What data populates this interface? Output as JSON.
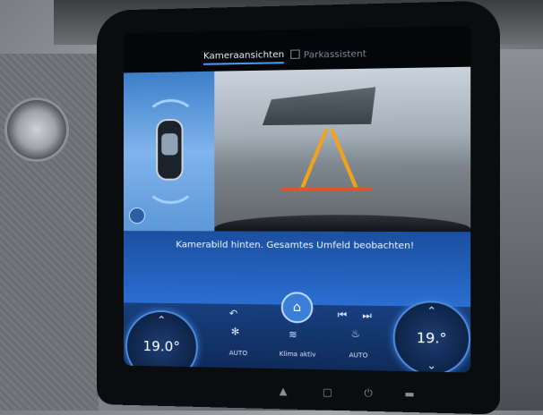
{
  "tabs": [
    {
      "label": "Kameraansichten",
      "active": true
    },
    {
      "label": "Parkassistent",
      "active": false
    }
  ],
  "camera": {
    "status_text": "Kamerabild hinten. Gesamtes Umfeld beobachten!"
  },
  "climate": {
    "left_temp": "19.0°",
    "right_temp": "19.°",
    "left_mode_label": "AUTO",
    "center_label": "Klima aktiv",
    "right_mode_label": "AUTO"
  },
  "icons": {
    "back": "back-arrow-icon",
    "home": "home-icon",
    "prev": "previous-track-icon",
    "next": "next-track-icon",
    "fan": "fan-icon",
    "defrost": "defrost-icon",
    "seat": "seat-heat-icon"
  },
  "colors": {
    "accent": "#3aa0ff",
    "screen_blue": "#2b6ed0",
    "guide_orange": "#f2a21f",
    "guide_red": "#e0532c"
  }
}
